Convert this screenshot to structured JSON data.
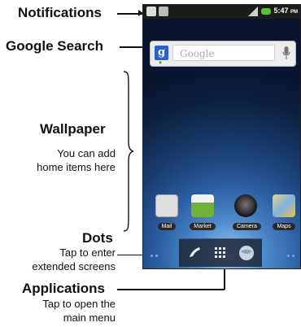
{
  "callouts": {
    "notifications": {
      "title": "Notifications"
    },
    "google_search": {
      "title": "Google Search"
    },
    "wallpaper": {
      "title": "Wallpaper",
      "desc_line1": "You can add",
      "desc_line2": "home items here"
    },
    "dots": {
      "title": "Dots",
      "desc_line1": "Tap to enter",
      "desc_line2": "extended screens"
    },
    "applications": {
      "title": "Applications",
      "desc_line1": "Tap to open the",
      "desc_line2": "main menu"
    }
  },
  "phone": {
    "status_bar": {
      "time": "5:47",
      "ampm": "PM"
    },
    "search": {
      "logo": "g",
      "placeholder": "Google"
    },
    "apps": [
      {
        "label": "Mail",
        "icon": "mail-icon",
        "color": "#d9d9d9"
      },
      {
        "label": "Market",
        "icon": "market-icon",
        "color": "#6fb23a"
      },
      {
        "label": "Camera",
        "icon": "camera-icon",
        "color": "#333333"
      },
      {
        "label": "Maps",
        "icon": "maps-icon",
        "color": "#e8c24a"
      }
    ],
    "dock": [
      "phone-icon",
      "app-grid-icon",
      "browser-icon"
    ]
  }
}
